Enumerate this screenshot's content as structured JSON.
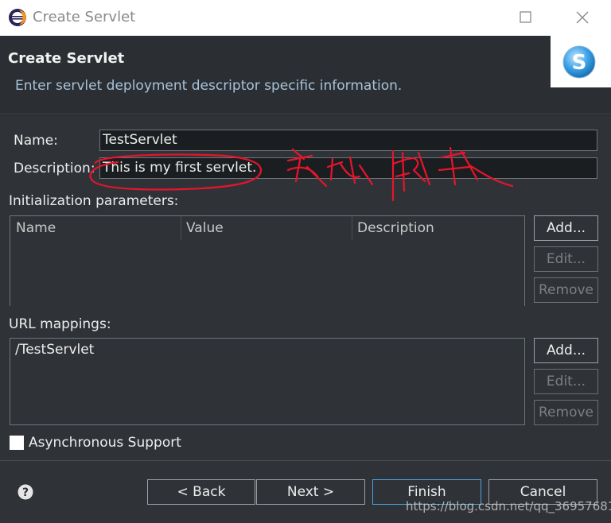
{
  "window": {
    "title": "Create Servlet",
    "icon": "eclipse-icon"
  },
  "header": {
    "title": "Create Servlet",
    "subtitle": "Enter servlet deployment descriptor specific information."
  },
  "form": {
    "name_label": "Name:",
    "name_value": "TestServlet",
    "description_label": "Description:",
    "description_value": "This is my first servlet."
  },
  "init_params": {
    "label": "Initialization parameters:",
    "columns": [
      "Name",
      "Value",
      "Description"
    ],
    "buttons": {
      "add": "Add...",
      "edit": "Edit...",
      "remove": "Remove"
    }
  },
  "url_mappings": {
    "label": "URL mappings:",
    "items": [
      "/TestServlet"
    ],
    "buttons": {
      "add": "Add...",
      "edit": "Edit...",
      "remove": "Remove"
    }
  },
  "async_support": {
    "label": "Asynchronous Support",
    "checked": false
  },
  "footer": {
    "back": "< Back",
    "next": "Next >",
    "finish": "Finish",
    "cancel": "Cancel"
  },
  "watermark": "https://blog.csdn.net/qq_36957681",
  "colors": {
    "background": "#2f3338",
    "annotation": "#e8142c",
    "primary_border": "#4aa3df"
  }
}
